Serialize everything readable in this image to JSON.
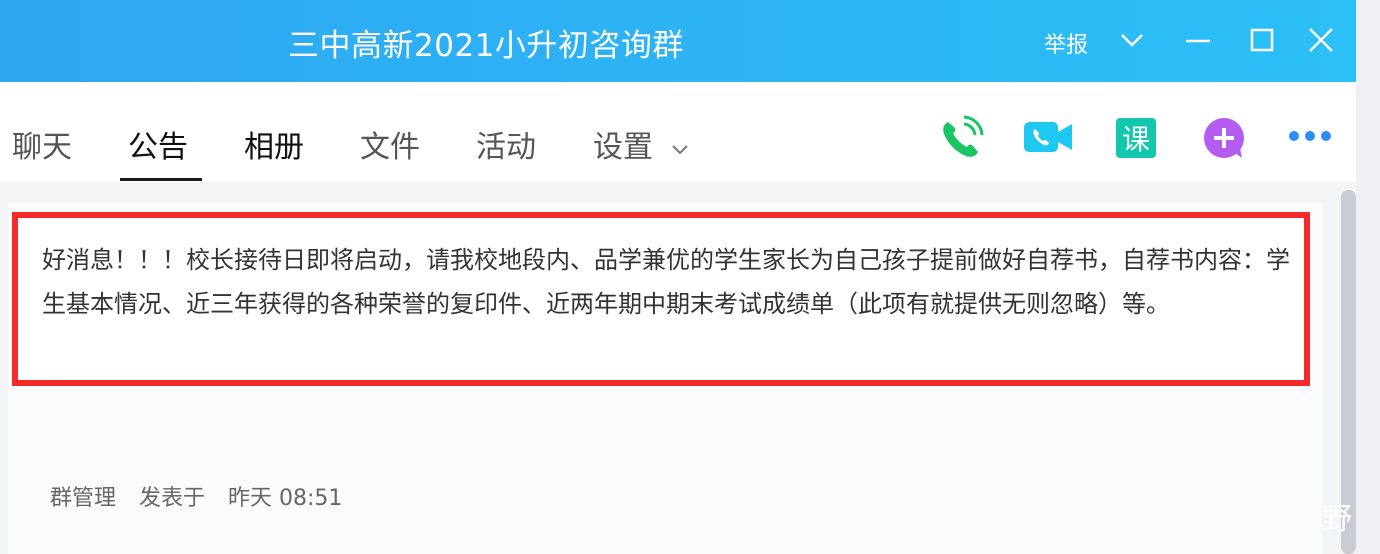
{
  "window": {
    "title": "三中高新2021小升初咨询群",
    "report_label": "举报"
  },
  "tabs": [
    {
      "label": "聊天"
    },
    {
      "label": "公告"
    },
    {
      "label": "相册"
    },
    {
      "label": "文件"
    },
    {
      "label": "活动"
    },
    {
      "label": "设置"
    }
  ],
  "toolbar": {
    "icons": [
      "phone-icon",
      "video-call-icon",
      "course-icon",
      "add-icon",
      "more-icon"
    ],
    "course_label": "课"
  },
  "announcement": {
    "text": "好消息！！！校长接待日即将启动，请我校地段内、品学兼优的学生家长为自己孩子提前做好自荐书，自荐书内容：学生基本情况、近三年获得的各种荣誉的复印件、近两年期中期末考试成绩单（此项有就提供无则忽略）等。",
    "author": "群管理",
    "posted_label": "发表于",
    "time": "昨天 08:51"
  },
  "watermark": "野",
  "colors": {
    "titlebar": "#2cb4f4",
    "highlight_border": "#f42a2a",
    "phone_green": "#18c463",
    "video_cyan": "#1ec8f0",
    "course_teal": "#12c7ad",
    "add_purple": "#b45bf0"
  }
}
